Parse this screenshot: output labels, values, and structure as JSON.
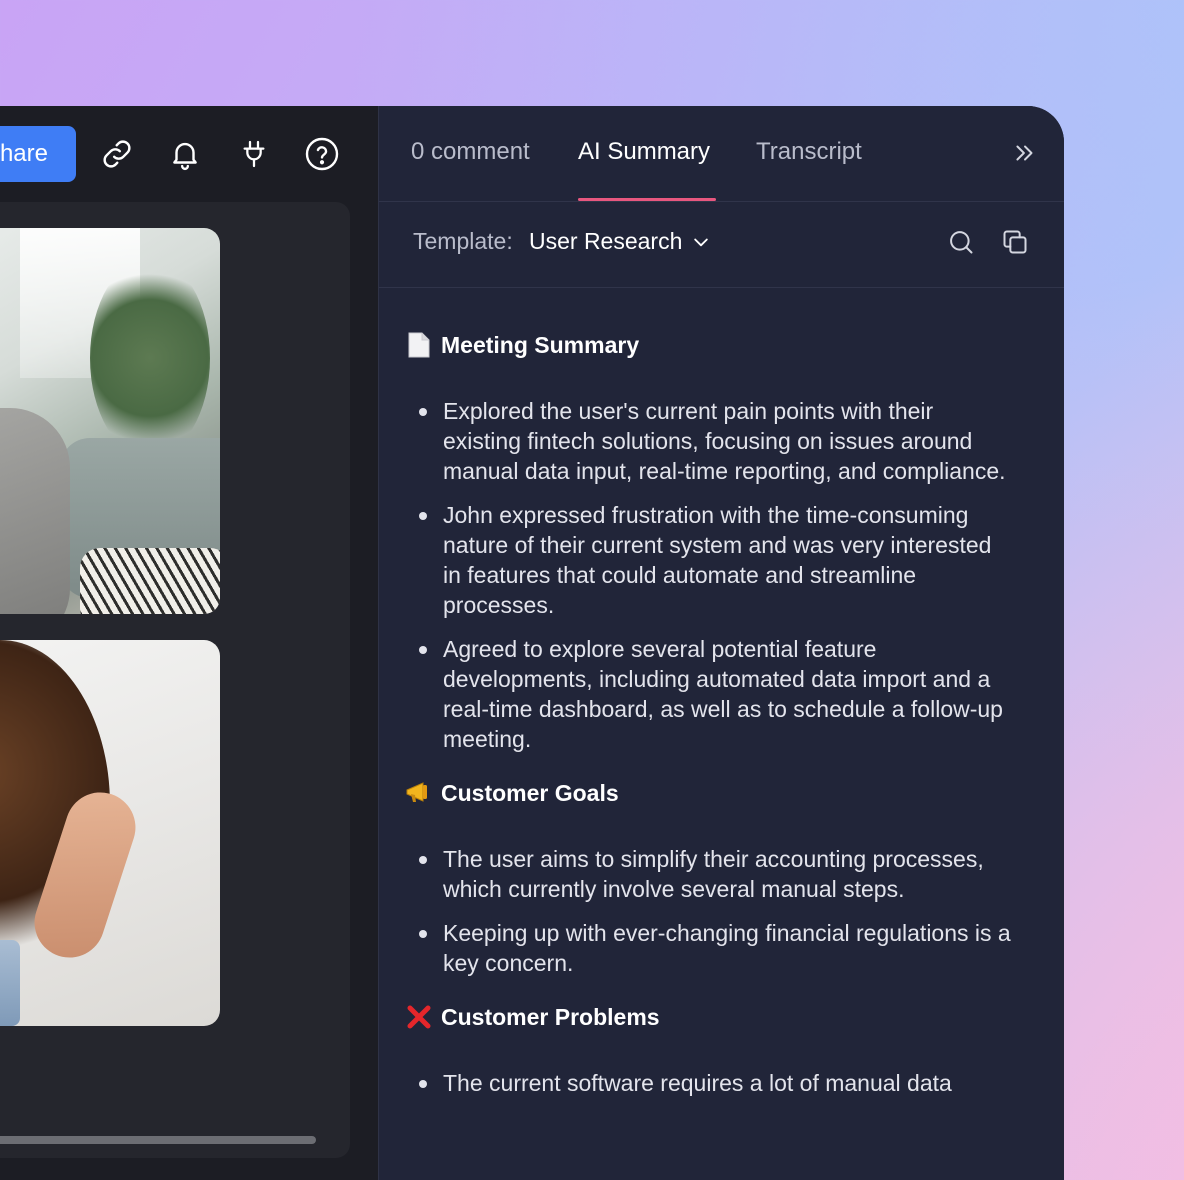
{
  "toolbar": {
    "share_label": "hare",
    "icons": [
      "link-icon",
      "bell-icon",
      "plug-icon",
      "help-icon"
    ]
  },
  "tabs": [
    {
      "label": "0 comment"
    },
    {
      "label": "AI Summary"
    },
    {
      "label": "Transcript"
    }
  ],
  "template": {
    "label": "Template:",
    "value": "User Research"
  },
  "sections": [
    {
      "emoji": "page-icon",
      "title": "Meeting Summary",
      "bullets": [
        "Explored the user's current pain points with their existing fintech solutions, focusing on issues around manual data input, real-time reporting, and compliance.",
        "John expressed frustration with the time-consuming nature of their current system and was very interested in features that could automate and streamline processes.",
        "Agreed to explore several potential feature developments, including automated data import and a real-time dashboard, as well as to schedule a follow-up meeting."
      ]
    },
    {
      "emoji": "megaphone-icon",
      "title": "Customer Goals",
      "bullets": [
        "The user aims to simplify their accounting processes, which currently involve several manual steps.",
        "Keeping up with ever-changing financial regulations is a key concern."
      ]
    },
    {
      "emoji": "cross-mark-icon",
      "title": "Customer Problems",
      "bullets": [
        "The current software requires a lot of manual data"
      ]
    }
  ],
  "colors": {
    "accent": "#3f7df5",
    "tab_underline": "#e8577f",
    "panel_bg": "#212539",
    "cross": "#e5262b"
  }
}
